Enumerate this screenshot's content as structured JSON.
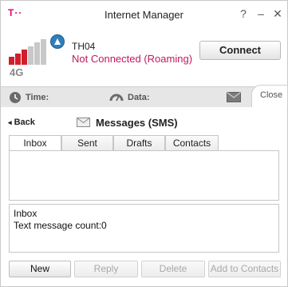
{
  "app": {
    "brand": "T··",
    "title": "Internet Manager"
  },
  "window_controls": {
    "help": "?",
    "minimize": "–",
    "close": "✕"
  },
  "connection": {
    "network_type": "4G",
    "network_name": "TH04",
    "status": "Not Connected (Roaming)",
    "connect_label": "Connect",
    "signal_bars_total": 6,
    "signal_bars_active": 3,
    "colors": {
      "signal_active": "#d21e2a",
      "signal_inactive": "#c8c8c8",
      "status": "#c2185b",
      "roaming_badge": "#2f7fbd"
    }
  },
  "stats": {
    "time_label": "Time:",
    "data_label": "Data:",
    "close_label": "Close"
  },
  "messages": {
    "back_label": "Back",
    "title": "Messages (SMS)",
    "tabs": [
      {
        "label": "Inbox"
      },
      {
        "label": "Sent"
      },
      {
        "label": "Drafts"
      },
      {
        "label": "Contacts"
      }
    ],
    "active_tab": "Inbox",
    "preview": {
      "folder": "Inbox",
      "count_line": "Text message count:0"
    }
  },
  "actions": {
    "new": "New",
    "reply": "Reply",
    "delete": "Delete",
    "add_to_contacts": "Add to Contacts"
  },
  "icons": {
    "clock": "clock-icon",
    "speedometer": "speedometer-icon",
    "envelope": "envelope-icon",
    "roaming": "roaming-icon",
    "back_arrow": "back-arrow-icon"
  }
}
